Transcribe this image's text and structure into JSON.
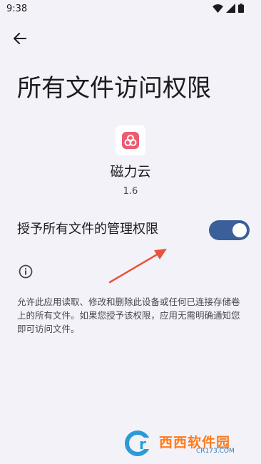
{
  "status_bar": {
    "time": "9:38"
  },
  "header": {
    "title": "所有文件访问权限"
  },
  "app": {
    "name": "磁力云",
    "version": "1.6"
  },
  "permission": {
    "label": "授予所有文件的管理权限",
    "enabled": true
  },
  "description": "允许此应用读取、修改和删除此设备或任何已连接存储卷上的所有文件。如果您授予该权限，应用无需明确通知您即可访问文件。",
  "watermark": {
    "text": "西西软件园",
    "site": "CR173.COM"
  },
  "colors": {
    "background": "#f3f2f8",
    "toggle_on": "#3a5f99",
    "app_icon_accent": "#ee5a6f",
    "annotation_arrow": "#e8543a"
  }
}
